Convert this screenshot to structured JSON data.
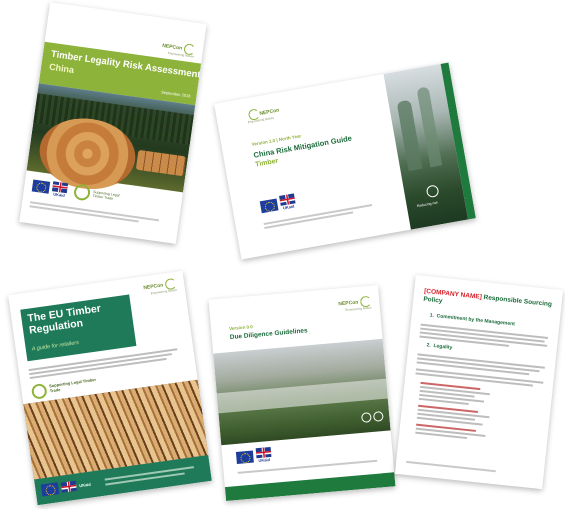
{
  "documents": [
    {
      "logo": "NEPCon",
      "logo_tagline": "Empowering Nature",
      "title": "Timber Legality Risk Assessment",
      "subtitle": "China",
      "date": "September 2016",
      "badge": "Supporting Legal Timber Trade",
      "ukaid": "UKaid"
    },
    {
      "logo": "NEPCon",
      "logo_tagline": "Empowering Nature",
      "version": "Version 1.0 | North Year",
      "title": "China Risk Mitigation Guide",
      "subtitle": "Timber",
      "side_label": "Reducing risk",
      "ukaid": "UKaid"
    },
    {
      "logo": "NEPCon",
      "logo_tagline": "Empowering Nature",
      "title": "The EU Timber Regulation",
      "subtitle": "A guide for retailers",
      "badge": "Supporting Legal Timber Trade",
      "ukaid": "UKaid"
    },
    {
      "logo": "NEPCon",
      "logo_tagline": "Empowering Nature",
      "version": "Version 0.0",
      "title": "Due Diligence Guidelines",
      "ukaid": "UKaid"
    },
    {
      "heading_bracket": "[COMPANY NAME]",
      "heading_rest": "Responsible Sourcing Policy",
      "section1": "Commitment by the Management",
      "section2": "Legality"
    }
  ]
}
